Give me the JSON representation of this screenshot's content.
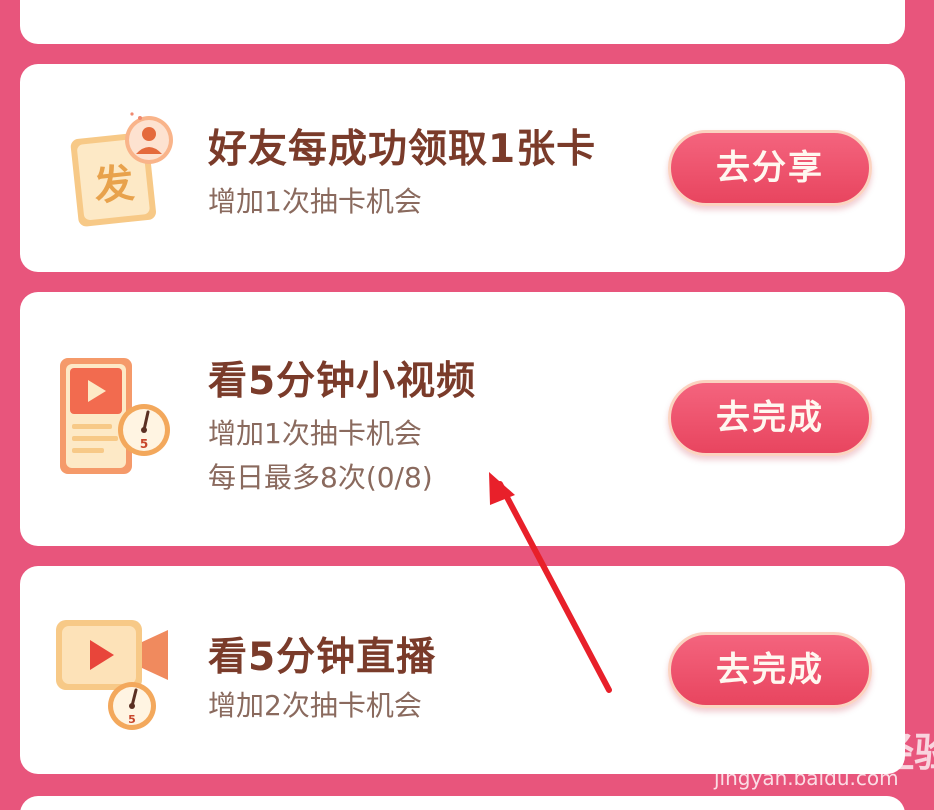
{
  "tasks": [
    {
      "icon": "red-envelope-share-icon",
      "title": "好友每成功领取1张卡",
      "subtitle": "增加1次抽卡机会",
      "button": "去分享"
    },
    {
      "icon": "video-timer-icon",
      "title": "看5分钟小视频",
      "subtitle": "增加1次抽卡机会",
      "limit": "每日最多8次(0/8)",
      "button": "去完成"
    },
    {
      "icon": "live-camera-timer-icon",
      "title": "看5分钟直播",
      "subtitle": "增加2次抽卡机会",
      "button": "去完成"
    }
  ],
  "icon_text": {
    "fa": "发",
    "timer_num": "5"
  },
  "watermark": {
    "logo": "Bai du 经验",
    "url": "jingyan.baidu.com"
  },
  "colors": {
    "background": "#e8557c",
    "card": "#ffffff",
    "title": "#7a3b2a",
    "subtitle": "#8a6a5e",
    "button": "#ee506c",
    "arrow": "#e8202a"
  }
}
